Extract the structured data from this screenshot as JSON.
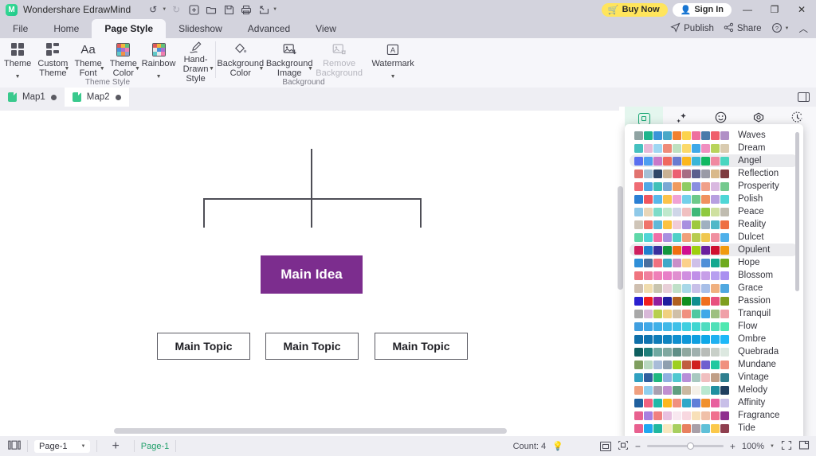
{
  "titlebar": {
    "app_name": "Wondershare EdrawMind",
    "logo_glyph": "M",
    "tools": [
      {
        "name": "undo-button",
        "glyph": "↺",
        "caret": true,
        "disabled": false
      },
      {
        "name": "redo-button",
        "glyph": "↻",
        "caret": false,
        "disabled": true
      },
      {
        "name": "new-button",
        "glyph": "⊞",
        "caret": false,
        "disabled": false
      },
      {
        "name": "open-button",
        "glyph": "🗁",
        "caret": false,
        "disabled": false
      },
      {
        "name": "save-button",
        "glyph": "🖫",
        "caret": false,
        "disabled": false
      },
      {
        "name": "print-button",
        "glyph": "🖶",
        "caret": false,
        "disabled": false
      },
      {
        "name": "export-button",
        "glyph": "🡕",
        "caret": true,
        "disabled": false
      }
    ],
    "buy_now": "Buy Now",
    "sign_in": "Sign In",
    "minimize": "—",
    "maximize": "❐",
    "close": "✕"
  },
  "ribbon_tabs": {
    "items": [
      "File",
      "Home",
      "Page Style",
      "Slideshow",
      "Advanced",
      "View"
    ],
    "active": "Page Style",
    "right": [
      {
        "name": "publish-button",
        "label": "Publish",
        "glyph": "➤"
      },
      {
        "name": "share-button",
        "label": "Share",
        "glyph": "⋖"
      },
      {
        "name": "help-button",
        "label": "",
        "glyph": "?",
        "caret": true
      },
      {
        "name": "collapse-ribbon-button",
        "label": "",
        "glyph": "︿"
      }
    ]
  },
  "ribbon": {
    "groups": [
      {
        "name": "Theme Style",
        "items": [
          {
            "label": "Theme",
            "icon": "theme-grid-icon",
            "dropdown": "below"
          },
          {
            "label": "Custom Theme",
            "icon": "custom-theme-grid-icon",
            "dropdown": "side"
          },
          {
            "label": "Theme Font",
            "icon": "theme-font-icon",
            "dropdown": "side"
          },
          {
            "label": "Theme Color",
            "icon": "theme-color-icon",
            "dropdown": "side"
          },
          {
            "label": "Rainbow",
            "icon": "rainbow-icon",
            "dropdown": "below"
          },
          {
            "label": "Hand-Drawn Style",
            "icon": "pen-icon",
            "dropdown": "side"
          }
        ]
      },
      {
        "name": "Background",
        "items": [
          {
            "label": "Background Color",
            "icon": "paint-bucket-icon",
            "dropdown": "side"
          },
          {
            "label": "Background Image",
            "icon": "image-insert-icon",
            "dropdown": "side"
          },
          {
            "label": "Remove Background",
            "icon": "image-remove-icon",
            "dropdown": "none",
            "disabled": true
          },
          {
            "label": "Watermark",
            "icon": "watermark-icon",
            "dropdown": "below"
          }
        ]
      }
    ]
  },
  "doc_tabs": {
    "items": [
      {
        "label": "Map1",
        "active": false,
        "modified": true
      },
      {
        "label": "Map2",
        "active": true,
        "modified": true
      }
    ],
    "right_icon": "split-panel-icon"
  },
  "canvas": {
    "root_node": "Main Idea",
    "root_color": "#7c2d8e",
    "topics": [
      "Main Topic",
      "Main Topic",
      "Main Topic"
    ],
    "topic_border": "#5b5b63",
    "connector_color": "#4e4e56"
  },
  "right_dock": {
    "tabs": [
      {
        "name": "style-tab",
        "glyph": "▣",
        "active": true
      },
      {
        "name": "ai-sparkle-tab",
        "glyph": "✦",
        "active": false
      },
      {
        "name": "emoji-tab",
        "glyph": "☺",
        "active": false
      },
      {
        "name": "clipart-tab",
        "glyph": "◈",
        "active": false
      },
      {
        "name": "history-tab",
        "glyph": "◷",
        "active": false
      }
    ]
  },
  "theme_panel": {
    "selected": "Angel",
    "highlighted": "Opulent",
    "themes": [
      {
        "name": "Waves",
        "colors": [
          "#8fa3a2",
          "#1fb58c",
          "#3a94d8",
          "#49a8c8",
          "#f2812f",
          "#fcd34d",
          "#ee6f9e",
          "#4a7aaa",
          "#ef5f6b",
          "#b08fc6"
        ]
      },
      {
        "name": "Dream",
        "colors": [
          "#45c0bf",
          "#e8b9d8",
          "#9fd6f2",
          "#ef8b79",
          "#bfe0c0",
          "#fbd96a",
          "#3fa9e8",
          "#f08fc0",
          "#b8d45b",
          "#d9cbb0"
        ]
      },
      {
        "name": "Angel",
        "colors": [
          "#5a6ff0",
          "#4e9ff0",
          "#c978c9",
          "#f0695f",
          "#6a7bd0",
          "#fbb71e",
          "#39b6d8",
          "#12b862",
          "#f089a0",
          "#49d6c0"
        ]
      },
      {
        "name": "Reflection",
        "colors": [
          "#e1736f",
          "#a3bfd4",
          "#2e4668",
          "#c9b193",
          "#ec5f72",
          "#a76c83",
          "#5c5f8e",
          "#9a9aa6",
          "#d9b98a",
          "#7e3b40"
        ]
      },
      {
        "name": "Prosperity",
        "colors": [
          "#ef6c74",
          "#4fa8e6",
          "#3fc0b8",
          "#7aa8d4",
          "#f09a5e",
          "#8fcc62",
          "#8a8fe0",
          "#f0a08a",
          "#d9b8e0",
          "#74c98e"
        ]
      },
      {
        "name": "Polish",
        "colors": [
          "#2a7fd4",
          "#f0565f",
          "#58b8ea",
          "#fbc34a",
          "#f0a2d4",
          "#74d0ea",
          "#6ec98a",
          "#f0915f",
          "#b79fe0",
          "#4fd6d6"
        ]
      },
      {
        "name": "Peace",
        "colors": [
          "#8fc9e8",
          "#e8d6b8",
          "#7ddcc8",
          "#bfe8cc",
          "#cfd6e8",
          "#f0bfc0",
          "#3fb878",
          "#8fc93f",
          "#cfe0a0",
          "#c0bcb0"
        ]
      },
      {
        "name": "Reality",
        "colors": [
          "#cfc5b8",
          "#f0746b",
          "#5fb8d8",
          "#fbc23f",
          "#f0cbd8",
          "#a98fe0",
          "#9ec93f",
          "#9fb0c0",
          "#4fb8c8",
          "#ee7044"
        ]
      },
      {
        "name": "Dulcet",
        "colors": [
          "#5fd8a8",
          "#4fd6d6",
          "#f06fa8",
          "#a98fe0",
          "#4fd0c8",
          "#f0a07a",
          "#b7cc4f",
          "#f0c84f",
          "#f08fa0",
          "#4fb0ea"
        ]
      },
      {
        "name": "Opulent",
        "colors": [
          "#cf1f5f",
          "#1f7fcf",
          "#3a2f9e",
          "#12963f",
          "#f06f0f",
          "#cf0f8f",
          "#9ecf0f",
          "#6a1f9e",
          "#cf0f2f",
          "#f09a0f"
        ]
      },
      {
        "name": "Hope",
        "colors": [
          "#2f8fd8",
          "#4a6f9e",
          "#f0707f",
          "#3fa8c8",
          "#c98fc8",
          "#fbd08a",
          "#cfc0e8",
          "#4f8fd8",
          "#12a88f",
          "#6faa1f"
        ]
      },
      {
        "name": "Blossom",
        "colors": [
          "#f0747f",
          "#f07f9e",
          "#ef7fb8",
          "#e87fc8",
          "#e08fd0",
          "#d08fe0",
          "#c08fe8",
          "#c79fe8",
          "#b79ff0",
          "#a98ff0"
        ]
      },
      {
        "name": "Grace",
        "colors": [
          "#cfbfb0",
          "#f0dcae",
          "#c8c4ae",
          "#e8cfd8",
          "#bfe0c8",
          "#a8d8e8",
          "#c8c0e8",
          "#a8bfe8",
          "#f0b07f",
          "#4fa8e0"
        ]
      },
      {
        "name": "Passion",
        "colors": [
          "#2a1fcf",
          "#f01f1f",
          "#8f1f9e",
          "#1f1f9e",
          "#b06020",
          "#0f8f1f",
          "#0f8f8f",
          "#f06f1f",
          "#e8507f",
          "#7f9e1f"
        ]
      },
      {
        "name": "Tranquil",
        "colors": [
          "#a8a8a8",
          "#d8b8d8",
          "#b7cf4f",
          "#f0d07f",
          "#cfbfa8",
          "#f0907f",
          "#4fc8a0",
          "#3fa8e8",
          "#9ec080",
          "#f0a0a8"
        ]
      },
      {
        "name": "Flow",
        "colors": [
          "#3f9fe0",
          "#3fa8e8",
          "#3fb0e8",
          "#3fb8e8",
          "#3fc0e8",
          "#3fcfe0",
          "#3fd6d0",
          "#4fdcc0",
          "#4fe0b8",
          "#4fe8b0"
        ]
      },
      {
        "name": "Ombre",
        "colors": [
          "#0f6fa8",
          "#0f74b0",
          "#0f7cb8",
          "#0f84c0",
          "#0f8fcf",
          "#0f97d8",
          "#0f9fe0",
          "#0fa8e8",
          "#1fb0f0",
          "#1fb8f8"
        ]
      },
      {
        "name": "Quebrada",
        "colors": [
          "#0f5f5f",
          "#1f7f7a",
          "#6fa8a0",
          "#7fa8a0",
          "#5f8f87",
          "#8fa8a0",
          "#9fb0ae",
          "#b8bcb8",
          "#c8cfc8",
          "#dce8e0"
        ]
      },
      {
        "name": "Mundane",
        "colors": [
          "#7f9e5f",
          "#b8d8c0",
          "#a8bcd8",
          "#8f9faf",
          "#9ecf1f",
          "#c05f3f",
          "#d01f1f",
          "#6f5fcf",
          "#1fc8a0",
          "#f0907f"
        ]
      },
      {
        "name": "Vintage",
        "colors": [
          "#2fa0c0",
          "#2f5f9e",
          "#1fb87f",
          "#8fb0e0",
          "#4fc8d0",
          "#b78fd8",
          "#a8c8c0",
          "#f0bfc0",
          "#c09f87",
          "#2f7f8f"
        ]
      },
      {
        "name": "Melody",
        "colors": [
          "#f0a07f",
          "#8fcfee",
          "#a8a0b0",
          "#c08fd0",
          "#5f9e7f",
          "#c9b8a0",
          "#f5f0e8",
          "#b8e8d0",
          "#1f8fa0",
          "#1f3f5f"
        ]
      },
      {
        "name": "Affinity",
        "colors": [
          "#1f5f9e",
          "#f0607f",
          "#1fb8a8",
          "#fbb71e",
          "#f0907f",
          "#2fa8c8",
          "#5f7fd8",
          "#f0902f",
          "#e8609e",
          "#c8bfe8"
        ]
      },
      {
        "name": "Fragrance",
        "colors": [
          "#e8608f",
          "#a87fe0",
          "#f0807f",
          "#e8c0e0",
          "#f8e8f0",
          "#f8d8e0",
          "#f8e0b8",
          "#f0c0a8",
          "#f0708f",
          "#8f2f8f"
        ]
      },
      {
        "name": "Tide",
        "colors": [
          "#e8608f",
          "#1fa8f0",
          "#1fb8a0",
          "#f8e8c0",
          "#a8cf5f",
          "#e8805f",
          "#a89fa8",
          "#5fc0d8",
          "#fbc84a",
          "#8f3f4f"
        ]
      }
    ]
  },
  "status_bar": {
    "outline_icon": "outline-view-icon",
    "page_select": "Page-1",
    "add_page": "+",
    "page_tag": "Page-1",
    "count_label": "Count: 4",
    "count_icon": "bulb-icon",
    "fit_icon": "fit-page-icon",
    "center_icon": "center-icon",
    "zoom_minus": "−",
    "zoom_plus": "+",
    "zoom_level": "100%",
    "fullscreen_icon": "fullscreen-icon",
    "presentation_icon": "presentation-icon"
  }
}
